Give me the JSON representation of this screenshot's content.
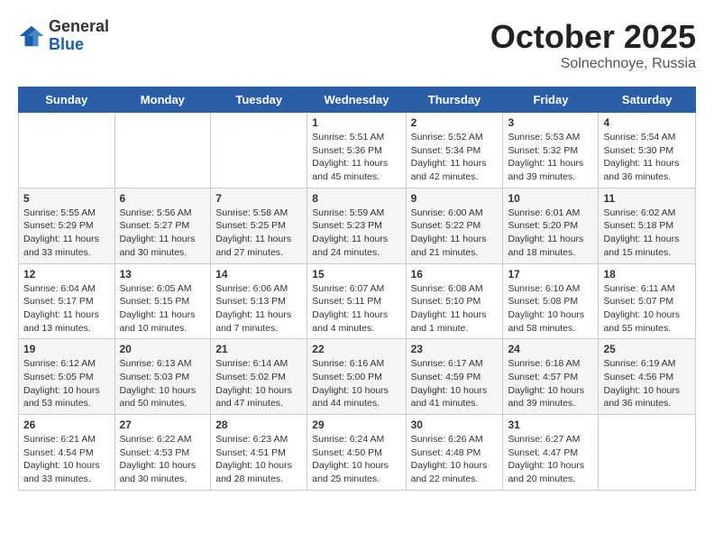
{
  "logo": {
    "general": "General",
    "blue": "Blue"
  },
  "title": "October 2025",
  "subtitle": "Solnechnoye, Russia",
  "weekdays": [
    "Sunday",
    "Monday",
    "Tuesday",
    "Wednesday",
    "Thursday",
    "Friday",
    "Saturday"
  ],
  "weeks": [
    [
      {
        "day": "",
        "info": ""
      },
      {
        "day": "",
        "info": ""
      },
      {
        "day": "",
        "info": ""
      },
      {
        "day": "1",
        "info": "Sunrise: 5:51 AM\nSunset: 5:36 PM\nDaylight: 11 hours\nand 45 minutes."
      },
      {
        "day": "2",
        "info": "Sunrise: 5:52 AM\nSunset: 5:34 PM\nDaylight: 11 hours\nand 42 minutes."
      },
      {
        "day": "3",
        "info": "Sunrise: 5:53 AM\nSunset: 5:32 PM\nDaylight: 11 hours\nand 39 minutes."
      },
      {
        "day": "4",
        "info": "Sunrise: 5:54 AM\nSunset: 5:30 PM\nDaylight: 11 hours\nand 36 minutes."
      }
    ],
    [
      {
        "day": "5",
        "info": "Sunrise: 5:55 AM\nSunset: 5:29 PM\nDaylight: 11 hours\nand 33 minutes."
      },
      {
        "day": "6",
        "info": "Sunrise: 5:56 AM\nSunset: 5:27 PM\nDaylight: 11 hours\nand 30 minutes."
      },
      {
        "day": "7",
        "info": "Sunrise: 5:58 AM\nSunset: 5:25 PM\nDaylight: 11 hours\nand 27 minutes."
      },
      {
        "day": "8",
        "info": "Sunrise: 5:59 AM\nSunset: 5:23 PM\nDaylight: 11 hours\nand 24 minutes."
      },
      {
        "day": "9",
        "info": "Sunrise: 6:00 AM\nSunset: 5:22 PM\nDaylight: 11 hours\nand 21 minutes."
      },
      {
        "day": "10",
        "info": "Sunrise: 6:01 AM\nSunset: 5:20 PM\nDaylight: 11 hours\nand 18 minutes."
      },
      {
        "day": "11",
        "info": "Sunrise: 6:02 AM\nSunset: 5:18 PM\nDaylight: 11 hours\nand 15 minutes."
      }
    ],
    [
      {
        "day": "12",
        "info": "Sunrise: 6:04 AM\nSunset: 5:17 PM\nDaylight: 11 hours\nand 13 minutes."
      },
      {
        "day": "13",
        "info": "Sunrise: 6:05 AM\nSunset: 5:15 PM\nDaylight: 11 hours\nand 10 minutes."
      },
      {
        "day": "14",
        "info": "Sunrise: 6:06 AM\nSunset: 5:13 PM\nDaylight: 11 hours\nand 7 minutes."
      },
      {
        "day": "15",
        "info": "Sunrise: 6:07 AM\nSunset: 5:11 PM\nDaylight: 11 hours\nand 4 minutes."
      },
      {
        "day": "16",
        "info": "Sunrise: 6:08 AM\nSunset: 5:10 PM\nDaylight: 11 hours\nand 1 minute."
      },
      {
        "day": "17",
        "info": "Sunrise: 6:10 AM\nSunset: 5:08 PM\nDaylight: 10 hours\nand 58 minutes."
      },
      {
        "day": "18",
        "info": "Sunrise: 6:11 AM\nSunset: 5:07 PM\nDaylight: 10 hours\nand 55 minutes."
      }
    ],
    [
      {
        "day": "19",
        "info": "Sunrise: 6:12 AM\nSunset: 5:05 PM\nDaylight: 10 hours\nand 53 minutes."
      },
      {
        "day": "20",
        "info": "Sunrise: 6:13 AM\nSunset: 5:03 PM\nDaylight: 10 hours\nand 50 minutes."
      },
      {
        "day": "21",
        "info": "Sunrise: 6:14 AM\nSunset: 5:02 PM\nDaylight: 10 hours\nand 47 minutes."
      },
      {
        "day": "22",
        "info": "Sunrise: 6:16 AM\nSunset: 5:00 PM\nDaylight: 10 hours\nand 44 minutes."
      },
      {
        "day": "23",
        "info": "Sunrise: 6:17 AM\nSunset: 4:59 PM\nDaylight: 10 hours\nand 41 minutes."
      },
      {
        "day": "24",
        "info": "Sunrise: 6:18 AM\nSunset: 4:57 PM\nDaylight: 10 hours\nand 39 minutes."
      },
      {
        "day": "25",
        "info": "Sunrise: 6:19 AM\nSunset: 4:56 PM\nDaylight: 10 hours\nand 36 minutes."
      }
    ],
    [
      {
        "day": "26",
        "info": "Sunrise: 6:21 AM\nSunset: 4:54 PM\nDaylight: 10 hours\nand 33 minutes."
      },
      {
        "day": "27",
        "info": "Sunrise: 6:22 AM\nSunset: 4:53 PM\nDaylight: 10 hours\nand 30 minutes."
      },
      {
        "day": "28",
        "info": "Sunrise: 6:23 AM\nSunset: 4:51 PM\nDaylight: 10 hours\nand 28 minutes."
      },
      {
        "day": "29",
        "info": "Sunrise: 6:24 AM\nSunset: 4:50 PM\nDaylight: 10 hours\nand 25 minutes."
      },
      {
        "day": "30",
        "info": "Sunrise: 6:26 AM\nSunset: 4:48 PM\nDaylight: 10 hours\nand 22 minutes."
      },
      {
        "day": "31",
        "info": "Sunrise: 6:27 AM\nSunset: 4:47 PM\nDaylight: 10 hours\nand 20 minutes."
      },
      {
        "day": "",
        "info": ""
      }
    ]
  ]
}
